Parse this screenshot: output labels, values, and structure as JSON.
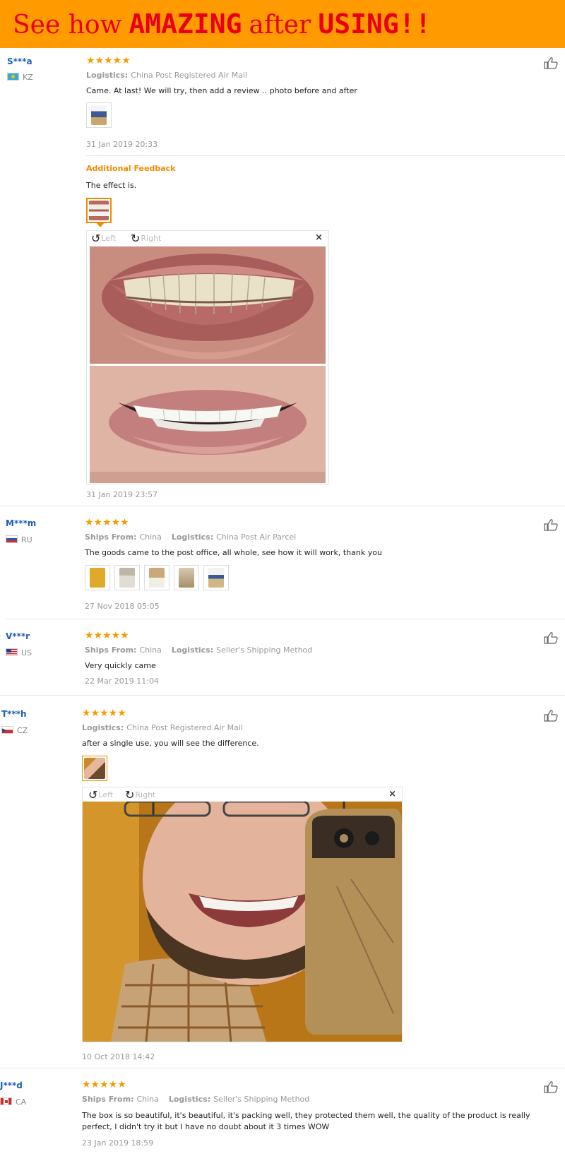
{
  "banner": {
    "part1": "See how",
    "part2": "AMAZING",
    "part3": "after",
    "part4": "USING!!"
  },
  "labels": {
    "logistics": "Logistics:",
    "ships_from": "Ships From:",
    "additional_feedback": "Additional Feedback",
    "rotate_left": "Left",
    "rotate_right": "Right",
    "close": "×"
  },
  "reviews": [
    {
      "user": "S***a",
      "country": "KZ",
      "stars": "★★★★★",
      "logistics": "China Post Registered Air Mail",
      "text": "Came. At last! We will try, then add a review .. photo before and after",
      "date": "31 Jan 2019 20:33",
      "additional": {
        "text": "The effect is.",
        "date": "31 Jan 2019 23:57"
      }
    },
    {
      "user": "M***m",
      "country": "RU",
      "stars": "★★★★★",
      "ships_from": "China",
      "logistics": "China Post Air Parcel",
      "text": "The goods came to the post office, all whole, see how it will work, thank you",
      "date": "27 Nov 2018 05:05"
    },
    {
      "user": "V***r",
      "country": "US",
      "stars": "★★★★★",
      "ships_from": "China",
      "logistics": "Seller's Shipping Method",
      "text": "Very quickly came",
      "date": "22 Mar 2019 11:04"
    },
    {
      "user": "T***h",
      "country": "CZ",
      "stars": "★★★★★",
      "logistics": "China Post Registered Air Mail",
      "text": "after a single use, you will see the difference.",
      "date": "10 Oct 2018 14:42"
    },
    {
      "user": "J***d",
      "country": "CA",
      "stars": "★★★★★",
      "ships_from": "China",
      "logistics": "Seller's Shipping Method",
      "text": "The box is so beautiful, it's beautiful, it's packing well, they protected them well, the quality of the product is really perfect, I didn't try it but I have no doubt about it 3 times WOW",
      "date": "23 Jan 2019 18:59"
    }
  ],
  "colors": {
    "banner_bg": "#ff9a00",
    "banner_text": "#e8001b",
    "username": "#1a5fb4",
    "stars": "#f59d00",
    "additional_feedback": "#f08c00"
  },
  "icons": [
    "thumbs-up-icon",
    "rotate-left-icon",
    "rotate-right-icon",
    "close-icon",
    "country-flag-icon"
  ]
}
